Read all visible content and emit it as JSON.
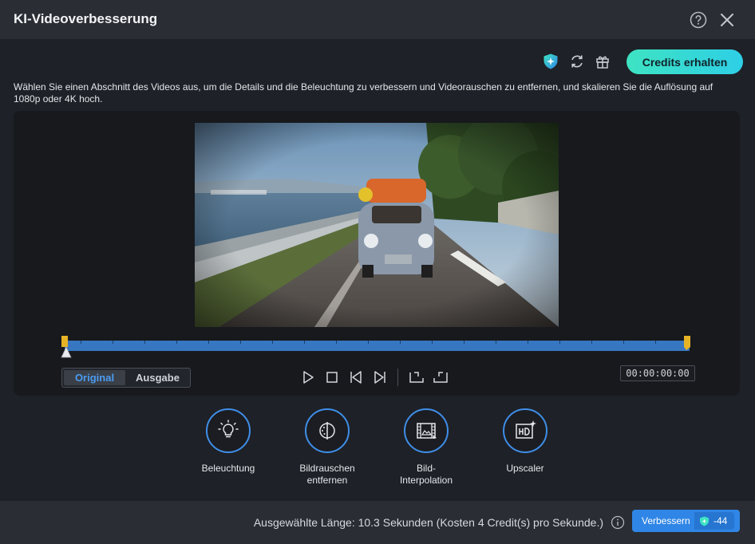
{
  "window": {
    "title": "KI-Videoverbesserung"
  },
  "toolbar": {
    "credits_label": "Credits erhalten"
  },
  "description": "Wählen Sie einen Abschnitt des Videos aus, um die Details und die Beleuchtung zu verbessern und Videorauschen zu entfernen, und skalieren Sie die Auflösung auf 1080p oder 4K hoch.",
  "view_toggle": {
    "original": "Original",
    "output": "Ausgabe",
    "selected": "Original"
  },
  "playback": {
    "timecode": "00:00:00:00"
  },
  "tools": [
    {
      "label": "Beleuchtung",
      "icon": "lightbulb-icon"
    },
    {
      "label": "Bildrauschen entfernen",
      "icon": "denoise-icon"
    },
    {
      "label": "Bild-Interpolation",
      "icon": "film-interpolation-icon"
    },
    {
      "label": "Upscaler",
      "icon": "hd-upscale-icon"
    }
  ],
  "footer": {
    "selection_info": "Ausgewählte Länge: 10.3 Sekunden (Kosten 4 Credit(s) pro Sekunde.)",
    "enhance_label": "Verbessern",
    "cost": "-44"
  },
  "colors": {
    "accent": "#2f86e6",
    "timeline": "#3777c2",
    "credits_gradient_start": "#3ee3c2",
    "credits_gradient_end": "#2ecfe6"
  }
}
